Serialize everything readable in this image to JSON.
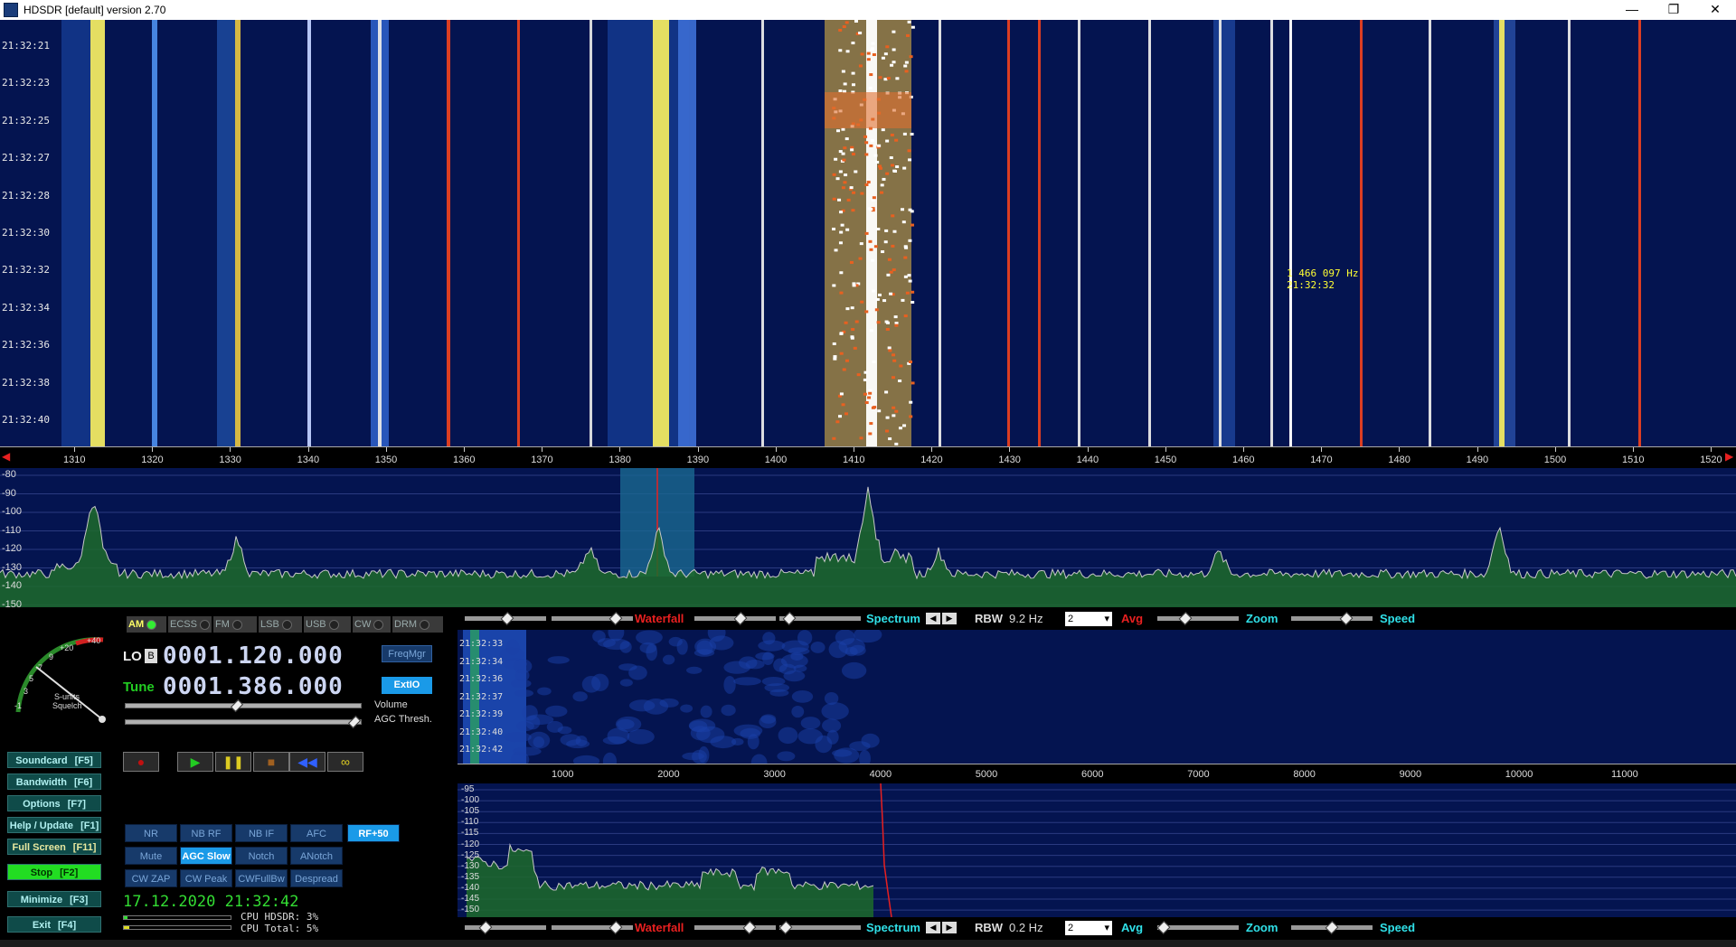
{
  "window": {
    "title": "HDSDR [default]  version 2.70",
    "buttons": [
      "—",
      "❐",
      "✕"
    ]
  },
  "main_waterfall": {
    "times": [
      "21:32:21",
      "21:32:23",
      "21:32:25",
      "21:32:27",
      "21:32:28",
      "21:32:30",
      "21:32:32",
      "21:32:34",
      "21:32:36",
      "21:32:38",
      "21:32:40"
    ],
    "cursor_freq": "1 466 097 Hz",
    "cursor_time": "21:32:32"
  },
  "main_freq_axis": {
    "ticks": [
      "1310",
      "1320",
      "1330",
      "1340",
      "1350",
      "1360",
      "1370",
      "1380",
      "1390",
      "1400",
      "1410",
      "1420",
      "1430",
      "1440",
      "1450",
      "1460",
      "1470",
      "1480",
      "1490",
      "1500",
      "1510",
      "1520"
    ]
  },
  "main_spectrum": {
    "y_labels": [
      "-80",
      "-90",
      "-100",
      "-110",
      "-120",
      "-130",
      "-140",
      "-150"
    ]
  },
  "modes": [
    {
      "label": "AM",
      "on": true
    },
    {
      "label": "ECSS",
      "on": false
    },
    {
      "label": "FM",
      "on": false
    },
    {
      "label": "LSB",
      "on": false
    },
    {
      "label": "USB",
      "on": false
    },
    {
      "label": "CW",
      "on": false
    },
    {
      "label": "DRM",
      "on": false
    }
  ],
  "smeter": {
    "scale": [
      "-1",
      "3",
      "5",
      "7",
      "9",
      "+20",
      "+40"
    ],
    "label1": "S-units",
    "label2": "Squelch"
  },
  "lo": {
    "label": "LO",
    "badge": "B",
    "value": "0001.120.000",
    "button": "FreqMgr"
  },
  "tune": {
    "label": "Tune",
    "value": "0001.386.000",
    "button": "ExtIO"
  },
  "sliders": {
    "volume": "Volume",
    "agc": "AGC Thresh.",
    "volume_level": 0.47,
    "agc_level": 0.98
  },
  "transport": [
    "record",
    "play",
    "pause",
    "stop",
    "rewind",
    "loop"
  ],
  "fkeys": [
    {
      "label": "Soundcard",
      "key": "[F5]"
    },
    {
      "label": "Bandwidth",
      "key": "[F6]"
    },
    {
      "label": "Options",
      "key": "[F7]"
    },
    {
      "label": "Help / Update",
      "key": "[F1]"
    },
    {
      "label": "Full Screen",
      "key": "[F11]"
    },
    {
      "label": "Stop",
      "key": "[F2]"
    },
    {
      "label": "Minimize",
      "key": "[F3]"
    },
    {
      "label": "Exit",
      "key": "[F4]"
    }
  ],
  "dsp_buttons": {
    "row1": [
      {
        "label": "NR",
        "on": false
      },
      {
        "label": "NB RF",
        "on": false
      },
      {
        "label": "NB IF",
        "on": false
      },
      {
        "label": "AFC",
        "on": false
      },
      {
        "label": "RF+50",
        "on": true
      }
    ],
    "row2": [
      {
        "label": "Mute",
        "on": false
      },
      {
        "label": "AGC Slow",
        "on": true
      },
      {
        "label": "Notch",
        "on": false
      },
      {
        "label": "ANotch",
        "on": false
      }
    ],
    "row3": [
      {
        "label": "CW ZAP",
        "on": false
      },
      {
        "label": "CW Peak",
        "on": false
      },
      {
        "label": "CWFullBw",
        "on": false
      },
      {
        "label": "Despread",
        "on": false
      }
    ]
  },
  "datetime": "17.12.2020 21:32:42",
  "cpu": {
    "hdsdr": "CPU HDSDR:  3%",
    "total": "CPU Total:  5%"
  },
  "controlbar_top": {
    "waterfall": "Waterfall",
    "spectrum": "Spectrum",
    "rbw_label": "RBW",
    "rbw_value": "9.2 Hz",
    "avg_value": "2",
    "avg": "Avg",
    "zoom": "Zoom",
    "speed": "Speed"
  },
  "controlbar_bottom": {
    "waterfall": "Waterfall",
    "spectrum": "Spectrum",
    "rbw_label": "RBW",
    "rbw_value": "0.2 Hz",
    "avg_value": "2",
    "avg": "Avg",
    "zoom": "Zoom",
    "speed": "Speed"
  },
  "audio_waterfall": {
    "times": [
      "21:32:33",
      "21:32:34",
      "21:32:36",
      "21:32:37",
      "21:32:39",
      "21:32:40",
      "21:32:42"
    ]
  },
  "audio_axis": {
    "ticks": [
      "1000",
      "2000",
      "3000",
      "4000",
      "5000",
      "6000",
      "7000",
      "8000",
      "9000",
      "10000",
      "11000"
    ]
  },
  "audio_spectrum": {
    "y_labels": [
      "-95",
      "-100",
      "-105",
      "-110",
      "-115",
      "-120",
      "-125",
      "-130",
      "-135",
      "-140",
      "-145",
      "-150"
    ]
  },
  "colors": {
    "background": "#041450",
    "accent_red": "#e82020",
    "accent_cyan": "#30e0e8",
    "tune_green": "#22cc22",
    "cursor_yellow": "#ffff33"
  }
}
